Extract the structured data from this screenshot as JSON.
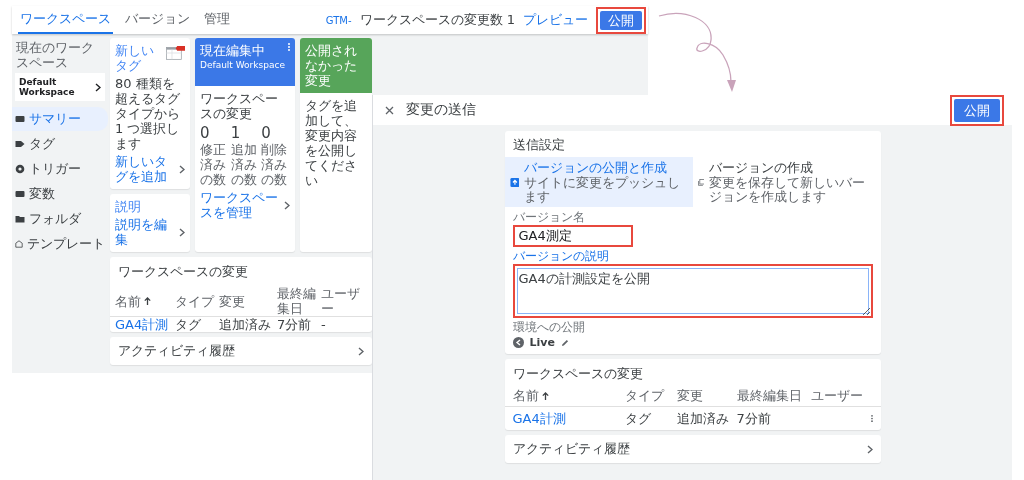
{
  "background_screen": {
    "tabs": [
      {
        "label": "ワークスペース",
        "selected": true
      },
      {
        "label": "バージョン",
        "selected": false
      },
      {
        "label": "管理",
        "selected": false
      }
    ],
    "container_id": "GTM-",
    "workspace_changes": "ワークスペースの変更数 1",
    "preview": "プレビュー",
    "publish_button": {
      "label": "公開",
      "highlighted": true
    },
    "sidebar": {
      "workspace_label": "現在のワークスペース",
      "workspace": "Default Workspace",
      "items": [
        {
          "label": "サマリー",
          "selected": true
        },
        {
          "label": "タグ",
          "selected": false
        },
        {
          "label": "トリガー",
          "selected": false
        },
        {
          "label": "変数",
          "selected": false
        },
        {
          "label": "フォルダ",
          "selected": false
        },
        {
          "label": "テンプレート",
          "selected": false
        }
      ]
    },
    "new_tag_card": {
      "title": "新しいタグ",
      "description": "80 種類を超えるタグタイプから 1 つ選択します",
      "link": "新しいタグを追加"
    },
    "description_card": {
      "title": "説明",
      "link": "説明を編集"
    },
    "editing_card": {
      "title": "現在編集中",
      "workspace": "Default Workspace",
      "changes_title": "ワークスペースの変更",
      "stats": [
        {
          "value": "0",
          "label": "修正済みの数"
        },
        {
          "value": "1",
          "label": "追加済みの数"
        },
        {
          "value": "0",
          "label": "削除済みの数"
        }
      ],
      "link": "ワークスペースを管理"
    },
    "unpublished_card": {
      "title": "公開されなかった変更",
      "message": "タグを追加して、変更内容を公開してください"
    },
    "changes_table": {
      "title": "ワークスペースの変更",
      "columns": [
        {
          "label": "名前",
          "sorted": true
        },
        {
          "label": "タイプ",
          "sorted": false
        },
        {
          "label": "変更",
          "sorted": false
        },
        {
          "label": "最終編集日",
          "sorted": false
        },
        {
          "label": "ユーザー",
          "sorted": false
        }
      ],
      "rows": [
        {
          "cells": [
            "GA4計測",
            "タグ",
            "追加済み",
            "7分前",
            "-"
          ]
        }
      ]
    },
    "activity": "アクティビティ履歴"
  },
  "dialog": {
    "title": "変更の送信",
    "publish_button": {
      "label": "公開",
      "highlighted": true
    },
    "settings": {
      "title": "送信設定",
      "options": [
        {
          "title": "バージョンの公開と作成",
          "subtitle": "サイトに変更をプッシュします",
          "selected": true
        },
        {
          "title": "バージョンの作成",
          "subtitle": "変更を保存して新しいバージョンを作成します",
          "selected": false
        }
      ],
      "version_name": {
        "label": "バージョン名",
        "value": "GA4測定",
        "highlighted": true
      },
      "version_description": {
        "label": "バージョンの説明",
        "value": "GA4の計測設定を公開",
        "highlighted": true
      },
      "environment": {
        "label": "環境への公開",
        "value": "Live"
      }
    },
    "changes_table": {
      "title": "ワークスペースの変更",
      "columns": [
        {
          "label": "名前",
          "sorted": true
        },
        {
          "label": "タイプ",
          "sorted": false
        },
        {
          "label": "変更",
          "sorted": false
        },
        {
          "label": "最終編集日",
          "sorted": false
        },
        {
          "label": "ユーザー",
          "sorted": false
        }
      ],
      "rows": [
        {
          "cells": [
            "GA4計測",
            "タグ",
            "追加済み",
            "7分前",
            ""
          ]
        }
      ]
    },
    "activity": "アクティビティ履歴"
  }
}
